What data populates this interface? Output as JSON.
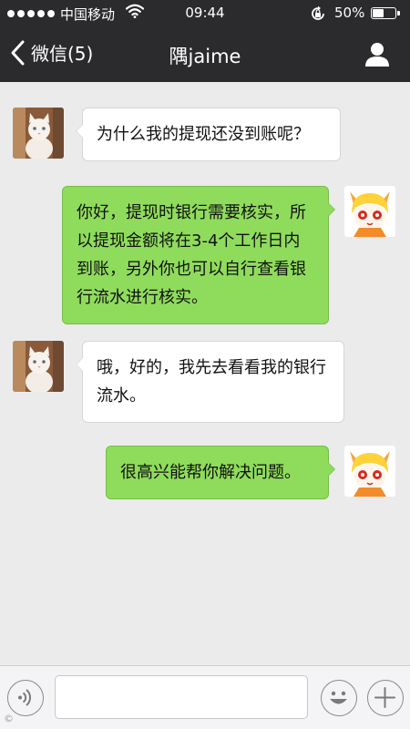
{
  "status_bar": {
    "carrier": "中国移动",
    "time": "09:44",
    "battery_percent": "50%",
    "battery_level": 0.5
  },
  "nav": {
    "back_label": "微信(5)",
    "title": "隅jaime"
  },
  "messages": [
    {
      "side": "incoming",
      "avatar": "cat-avatar",
      "text": "为什么我的提现还没到账呢？"
    },
    {
      "side": "outgoing",
      "avatar": "cartoon-girl-avatar",
      "text": "你好，提现时银行需要核实，所以提现金额将在3-4个工作日内到账，另外你也可以自行查看银行流水进行核实。"
    },
    {
      "side": "incoming",
      "avatar": "cat-avatar",
      "text": "哦，好的，我先去看看我的银行流水。"
    },
    {
      "side": "outgoing",
      "avatar": "cartoon-girl-avatar",
      "text": "很高兴能帮你解决问题。"
    }
  ],
  "input_bar": {
    "message_value": "",
    "icons": [
      "voice-icon",
      "emoji-icon",
      "plus-icon"
    ]
  },
  "watermark": "©"
}
